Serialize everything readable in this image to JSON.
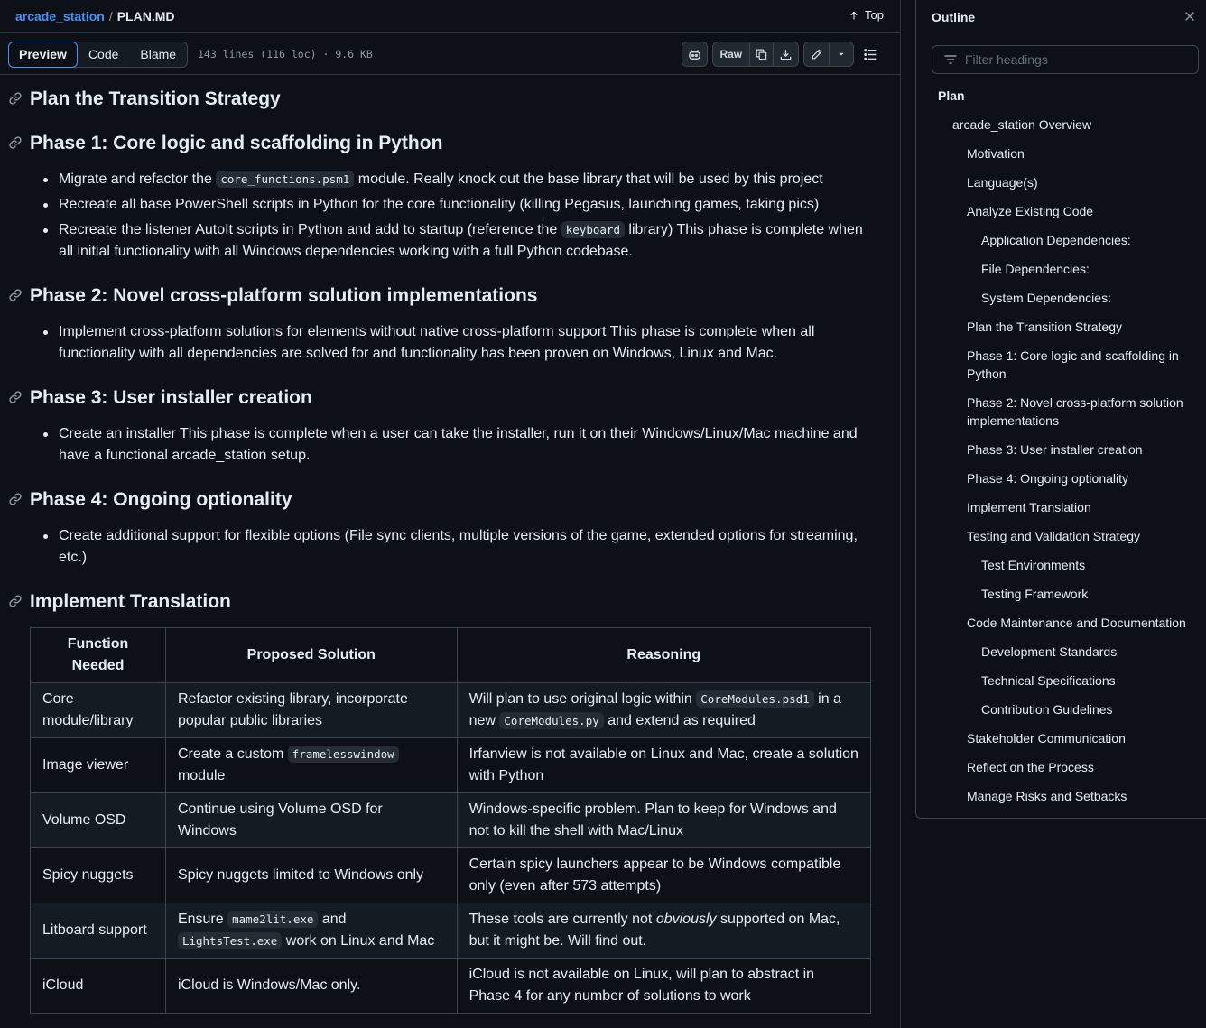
{
  "breadcrumb": {
    "repo": "arcade_station",
    "separator": "/",
    "file": "PLAN.MD"
  },
  "top_link": "Top",
  "toolbar": {
    "tabs": [
      "Preview",
      "Code",
      "Blame"
    ],
    "file_info": "143 lines (116 loc) · 9.6 KB",
    "raw_label": "Raw"
  },
  "sections": {
    "transition": {
      "title": "Plan the Transition Strategy"
    },
    "phase1": {
      "title": "Phase 1: Core logic and scaffolding in Python",
      "b1_pre": "Migrate and refactor the ",
      "b1_code": "core_functions.psm1",
      "b1_post": " module. Really knock out the base library that will be used by this project",
      "b2": "Recreate all base PowerShell scripts in Python for the core functionality (killing Pegasus, launching games, taking pics)",
      "b3_pre": "Recreate the listener AutoIt scripts in Python and add to startup (reference the ",
      "b3_code": "keyboard",
      "b3_post": " library) This phase is complete when all initial functionality with all Windows dependencies working with a full Python codebase."
    },
    "phase2": {
      "title": "Phase 2: Novel cross-platform solution implementations",
      "b1": "Implement cross-platform solutions for elements without native cross-platform support This phase is complete when all functionality with all dependencies are solved for and functionality has been proven on Windows, Linux and Mac."
    },
    "phase3": {
      "title": "Phase 3: User installer creation",
      "b1": "Create an installer This phase is complete when a user can take the installer, run it on their Windows/Linux/Mac machine and have a functional arcade_station setup."
    },
    "phase4": {
      "title": "Phase 4: Ongoing optionality",
      "b1": "Create additional support for flexible options (File sync clients, multiple versions of the game, extended options for streaming, etc.)"
    },
    "translation": {
      "title": "Implement Translation"
    }
  },
  "table": {
    "headers": [
      "Function Needed",
      "Proposed Solution",
      "Reasoning"
    ],
    "rows": [
      {
        "fn": "Core module/library",
        "sol": "Refactor existing library, incorporate popular public libraries",
        "r_pre": "Will plan to use original logic within ",
        "r_code1": "CoreModules.psd1",
        "r_mid": " in a new ",
        "r_code2": "CoreModules.py",
        "r_post": " and extend as required"
      },
      {
        "fn": "Image viewer",
        "sol_pre": "Create a custom ",
        "sol_code": "framelesswindow",
        "sol_post": " module",
        "reason": "Irfanview is not available on Linux and Mac, create a solution with Python"
      },
      {
        "fn": "Volume OSD",
        "sol": "Continue using Volume OSD for Windows",
        "reason": "Windows-specific problem. Plan to keep for Windows and not to kill the shell with Mac/Linux"
      },
      {
        "fn": "Spicy nuggets",
        "sol": "Spicy nuggets limited to Windows only",
        "reason": "Certain spicy launchers appear to be Windows compatible only (even after 573 attempts)"
      },
      {
        "fn": "Litboard support",
        "sol_pre": "Ensure ",
        "sol_code1": "mame2lit.exe",
        "sol_mid": " and ",
        "sol_code2": "LightsTest.exe",
        "sol_post": " work on Linux and Mac",
        "r_pre": "These tools are currently not ",
        "r_em": "obviously",
        "r_post": " supported on Mac, but it might be. Will find out."
      },
      {
        "fn": "iCloud",
        "sol": "iCloud is Windows/Mac only.",
        "reason": "iCloud is not available on Linux, will plan to abstract in Phase 4 for any number of solutions to work"
      }
    ]
  },
  "outline": {
    "title": "Outline",
    "filter_placeholder": "Filter headings",
    "items": [
      {
        "label": "Plan",
        "level": 1
      },
      {
        "label": "arcade_station Overview",
        "level": 2
      },
      {
        "label": "Motivation",
        "level": 3
      },
      {
        "label": "Language(s)",
        "level": 3
      },
      {
        "label": "Analyze Existing Code",
        "level": 3
      },
      {
        "label": "Application Dependencies:",
        "level": 4
      },
      {
        "label": "File Dependencies:",
        "level": 4
      },
      {
        "label": "System Dependencies:",
        "level": 4
      },
      {
        "label": "Plan the Transition Strategy",
        "level": 3
      },
      {
        "label": "Phase 1: Core logic and scaffolding in Python",
        "level": 3
      },
      {
        "label": "Phase 2: Novel cross-platform solution implementations",
        "level": 3
      },
      {
        "label": "Phase 3: User installer creation",
        "level": 3
      },
      {
        "label": "Phase 4: Ongoing optionality",
        "level": 3
      },
      {
        "label": "Implement Translation",
        "level": 3
      },
      {
        "label": "Testing and Validation Strategy",
        "level": 3
      },
      {
        "label": "Test Environments",
        "level": 4
      },
      {
        "label": "Testing Framework",
        "level": 4
      },
      {
        "label": "Code Maintenance and Documentation",
        "level": 3
      },
      {
        "label": "Development Standards",
        "level": 4
      },
      {
        "label": "Technical Specifications",
        "level": 4
      },
      {
        "label": "Contribution Guidelines",
        "level": 4
      },
      {
        "label": "Stakeholder Communication",
        "level": 3
      },
      {
        "label": "Reflect on the Process",
        "level": 3
      },
      {
        "label": "Manage Risks and Setbacks",
        "level": 3
      }
    ]
  },
  "icons": {
    "anchor": "link-icon",
    "top": "arrow-up-icon",
    "copilot": "copilot-icon",
    "copy": "copy-icon",
    "download": "download-icon",
    "edit": "pencil-icon",
    "dropdown": "triangle-down-icon",
    "outline": "list-unordered-icon",
    "close": "x-icon",
    "filter": "filter-icon"
  },
  "colors": {
    "background": "#0d1117",
    "link": "#4493f8",
    "border": "#30363d",
    "text": "#e6edf3",
    "muted": "#9198a1"
  }
}
